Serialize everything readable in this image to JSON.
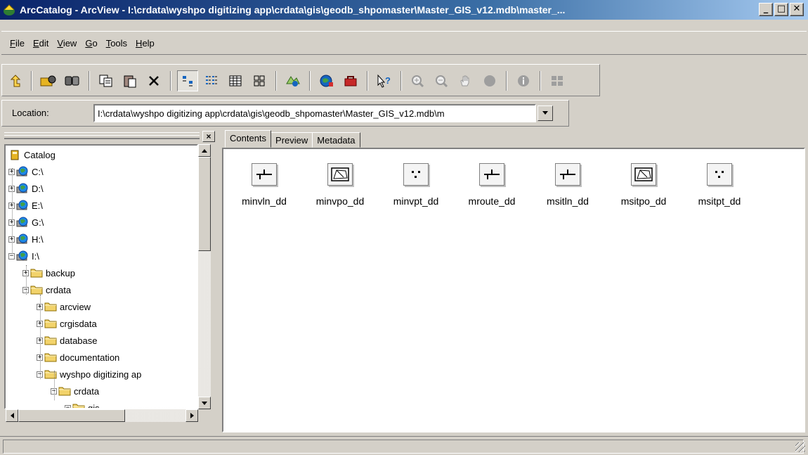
{
  "window": {
    "title": "ArcCatalog - ArcView - I:\\crdata\\wyshpo digitizing app\\crdata\\gis\\geodb_shpomaster\\Master_GIS_v12.mdb\\master_...",
    "minimize": "_",
    "maximize": "□",
    "close": "✕"
  },
  "menu": [
    {
      "key": "F",
      "rest": "ile"
    },
    {
      "key": "E",
      "rest": "dit"
    },
    {
      "key": "V",
      "rest": "iew"
    },
    {
      "key": "G",
      "rest": "o"
    },
    {
      "key": "T",
      "rest": "ools"
    },
    {
      "key": "H",
      "rest": "elp"
    }
  ],
  "location": {
    "label": "Location:",
    "value": "I:\\crdata\\wyshpo digitizing app\\crdata\\gis\\geodb_shpomaster\\Master_GIS_v12.mdb\\m"
  },
  "tree": {
    "close": "×",
    "nodes": [
      {
        "label": "Catalog",
        "icon": "catalog-icon",
        "expander": ""
      },
      {
        "label": "C:\\",
        "icon": "drive-icon",
        "expander": "+"
      },
      {
        "label": "D:\\",
        "icon": "drive-icon",
        "expander": "+"
      },
      {
        "label": "E:\\",
        "icon": "drive-icon",
        "expander": "+"
      },
      {
        "label": "G:\\",
        "icon": "drive-icon",
        "expander": "+"
      },
      {
        "label": "H:\\",
        "icon": "drive-icon",
        "expander": "+"
      },
      {
        "label": "I:\\",
        "icon": "drive-icon",
        "expander": "−"
      },
      {
        "label": "backup",
        "icon": "folder-icon",
        "expander": "+"
      },
      {
        "label": "crdata",
        "icon": "folder-icon",
        "expander": "−"
      },
      {
        "label": "arcview",
        "icon": "folder-icon",
        "expander": "+"
      },
      {
        "label": "crgisdata",
        "icon": "folder-icon",
        "expander": "+"
      },
      {
        "label": "database",
        "icon": "folder-icon",
        "expander": "+"
      },
      {
        "label": "documentation",
        "icon": "folder-icon",
        "expander": "+"
      },
      {
        "label": "wyshpo digitizing ap",
        "icon": "folder-icon",
        "expander": "−"
      },
      {
        "label": "crdata",
        "icon": "folder-icon",
        "expander": "−"
      },
      {
        "label": "gis",
        "icon": "folder-icon",
        "expander": "−"
      }
    ]
  },
  "tabs": [
    "Contents",
    "Preview",
    "Metadata"
  ],
  "contents": [
    {
      "label": "minvln_dd",
      "icon": "line-feature-icon"
    },
    {
      "label": "minvpo_dd",
      "icon": "polygon-feature-icon"
    },
    {
      "label": "minvpt_dd",
      "icon": "point-feature-icon"
    },
    {
      "label": "mroute_dd",
      "icon": "line-feature-icon"
    },
    {
      "label": "msitln_dd",
      "icon": "line-feature-icon"
    },
    {
      "label": "msitpo_dd",
      "icon": "polygon-feature-icon"
    },
    {
      "label": "msitpt_dd",
      "icon": "point-feature-icon"
    }
  ]
}
